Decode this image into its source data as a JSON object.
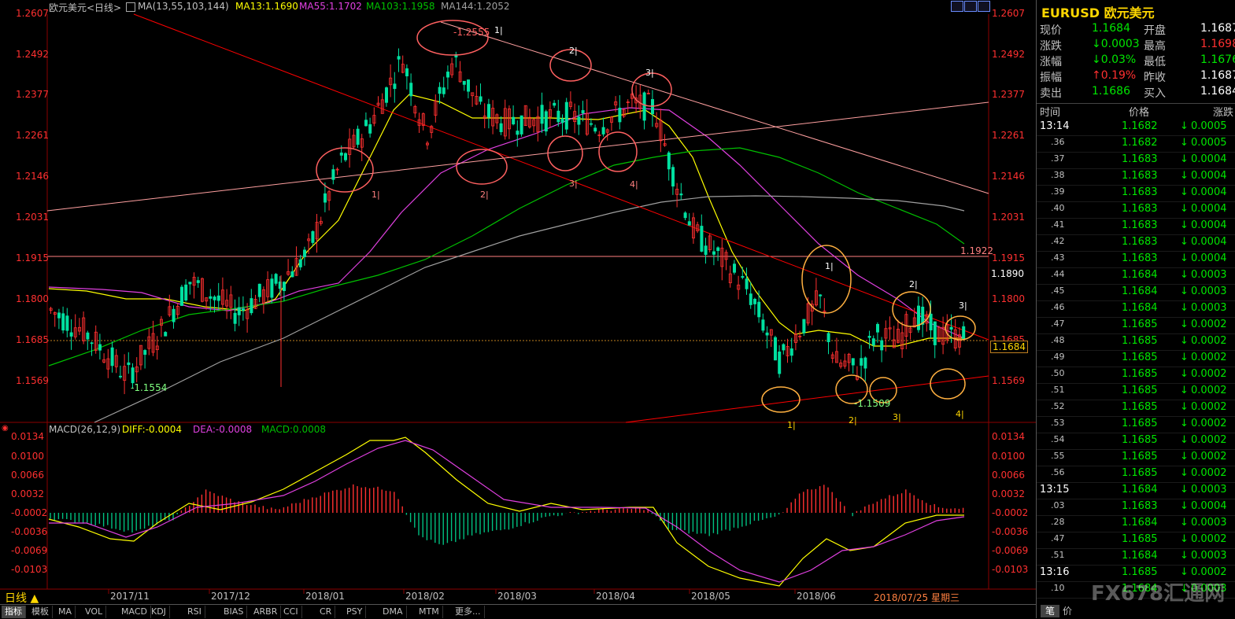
{
  "header": {
    "symbol_label": "欧元美元<日线>",
    "ma_label": "MA(13,55,103,144)",
    "ma13": "MA13:1.1690",
    "ma55": "MA55:1.1702",
    "ma103": "MA103:1.1958",
    "ma144": "MA144:1.2052",
    "macd_label": "MACD(26,12,9)",
    "diff": "DIFF:-0.0004",
    "dea": "DEA:-0.0008",
    "macd": "MACD:0.0008"
  },
  "colors": {
    "up": "#ff3030",
    "down": "#00e0a0",
    "ma13": "#ffff00",
    "ma55": "#e040e0",
    "ma103": "#00c000",
    "ma144": "#a0a0a0",
    "axis": "#ff3030",
    "trend": "#ff0000",
    "trend_light": "#ffa0a0",
    "circle_red": "#ff6060",
    "circle_orange": "#ffb040"
  },
  "price_axis": [
    "1.2607",
    "1.2492",
    "1.2377",
    "1.2261",
    "1.2146",
    "1.2031",
    "1.1915",
    "1.1800",
    "1.1685",
    "1.1569"
  ],
  "macd_axis": [
    "0.0134",
    "0.0100",
    "0.0066",
    "0.0032",
    "-0.0002",
    "-0.0036",
    "-0.0069",
    "-0.0103"
  ],
  "labels": {
    "price_1922": "1.1922",
    "price_1890": "1.1890",
    "price_current": "1.1684",
    "low_1554": "1.1554",
    "high_2555": "1.2555",
    "low_1509": "1.1509",
    "date_label": "2018/07/25 星期三"
  },
  "x_axis": [
    "2017/11",
    "2017/12",
    "2018/01",
    "2018/02",
    "2018/03",
    "2018/04",
    "2018/05",
    "2018/06"
  ],
  "wave_marks": [
    {
      "t": "1|"
    },
    {
      "t": "2|"
    },
    {
      "t": "3|"
    },
    {
      "t": "4|"
    },
    {
      "t": "1|"
    },
    {
      "t": "2|"
    },
    {
      "t": "3|"
    },
    {
      "t": "1|"
    },
    {
      "t": "2|"
    },
    {
      "t": "3|"
    },
    {
      "t": "1|"
    },
    {
      "t": "2|"
    },
    {
      "t": "3|"
    },
    {
      "t": "4|"
    }
  ],
  "bottom_tabs": [
    "指标",
    "模板",
    "MA",
    "VOL",
    "MACD",
    "KDJ",
    "RSI",
    "BIAS",
    "ARBR",
    "CCI",
    "CR",
    "PSY",
    "DMA",
    "MTM",
    "更多..."
  ],
  "period_label": "日线 ▲",
  "quote": {
    "title": "EURUSD 欧元美元",
    "rows": [
      {
        "l1": "现价",
        "v1": "1.1684",
        "l2": "开盘",
        "v2": "1.1687"
      },
      {
        "l1": "涨跌",
        "v1": "↓0.0003",
        "l2": "最高",
        "v2": "1.1698"
      },
      {
        "l1": "涨幅",
        "v1": "↓0.03%",
        "l2": "最低",
        "v2": "1.1676"
      },
      {
        "l1": "振幅",
        "v1": "↑0.19%",
        "l2": "昨收",
        "v2": "1.1687"
      },
      {
        "l1": "卖出",
        "v1": "1.1686",
        "l2": "买入",
        "v2": "1.1684"
      }
    ],
    "tick_header": {
      "time": "时间",
      "price": "价格",
      "change": "涨跌"
    },
    "ticks": [
      {
        "t": "13:14",
        "p": "1.1682",
        "c": "0.0005"
      },
      {
        "t": ".36",
        "p": "1.1682",
        "c": "0.0005"
      },
      {
        "t": ".37",
        "p": "1.1683",
        "c": "0.0004"
      },
      {
        "t": ".38",
        "p": "1.1683",
        "c": "0.0004"
      },
      {
        "t": ".39",
        "p": "1.1683",
        "c": "0.0004"
      },
      {
        "t": ".40",
        "p": "1.1683",
        "c": "0.0004"
      },
      {
        "t": ".41",
        "p": "1.1683",
        "c": "0.0004"
      },
      {
        "t": ".42",
        "p": "1.1683",
        "c": "0.0004"
      },
      {
        "t": ".43",
        "p": "1.1683",
        "c": "0.0004"
      },
      {
        "t": ".44",
        "p": "1.1684",
        "c": "0.0003"
      },
      {
        "t": ".45",
        "p": "1.1684",
        "c": "0.0003"
      },
      {
        "t": ".46",
        "p": "1.1684",
        "c": "0.0003"
      },
      {
        "t": ".47",
        "p": "1.1685",
        "c": "0.0002"
      },
      {
        "t": ".48",
        "p": "1.1685",
        "c": "0.0002"
      },
      {
        "t": ".49",
        "p": "1.1685",
        "c": "0.0002"
      },
      {
        "t": ".50",
        "p": "1.1685",
        "c": "0.0002"
      },
      {
        "t": ".51",
        "p": "1.1685",
        "c": "0.0002"
      },
      {
        "t": ".52",
        "p": "1.1685",
        "c": "0.0002"
      },
      {
        "t": ".53",
        "p": "1.1685",
        "c": "0.0002"
      },
      {
        "t": ".54",
        "p": "1.1685",
        "c": "0.0002"
      },
      {
        "t": ".55",
        "p": "1.1685",
        "c": "0.0002"
      },
      {
        "t": ".56",
        "p": "1.1685",
        "c": "0.0002"
      },
      {
        "t": "13:15",
        "p": "1.1684",
        "c": "0.0003"
      },
      {
        "t": ".03",
        "p": "1.1683",
        "c": "0.0004"
      },
      {
        "t": ".28",
        "p": "1.1684",
        "c": "0.0003"
      },
      {
        "t": ".47",
        "p": "1.1685",
        "c": "0.0002"
      },
      {
        "t": ".51",
        "p": "1.1684",
        "c": "0.0003"
      },
      {
        "t": "13:16",
        "p": "1.1685",
        "c": "0.0002"
      },
      {
        "t": ".10",
        "p": "1.1684",
        "c": "0.0003"
      }
    ],
    "bottom_tabs": [
      "笔",
      "价"
    ],
    "watermark": "FX678汇通网"
  }
}
